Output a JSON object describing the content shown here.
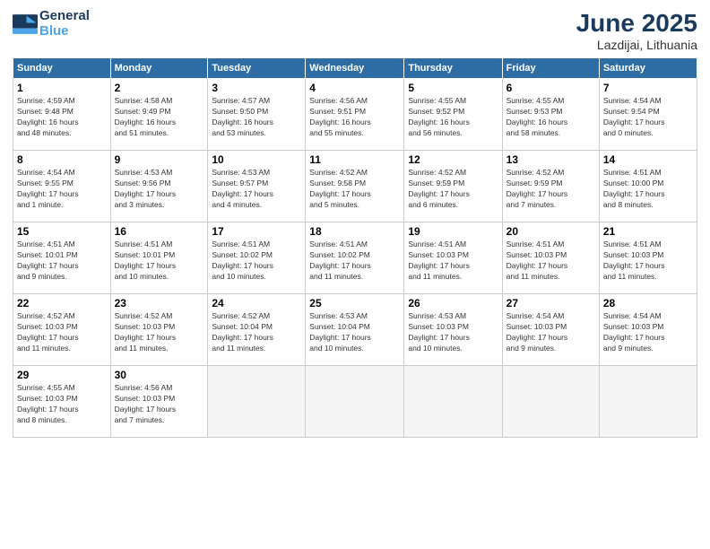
{
  "header": {
    "logo_line1": "General",
    "logo_line2": "Blue",
    "month": "June 2025",
    "location": "Lazdijai, Lithuania"
  },
  "weekdays": [
    "Sunday",
    "Monday",
    "Tuesday",
    "Wednesday",
    "Thursday",
    "Friday",
    "Saturday"
  ],
  "weeks": [
    [
      {
        "day": "1",
        "info": "Sunrise: 4:59 AM\nSunset: 9:48 PM\nDaylight: 16 hours\nand 48 minutes."
      },
      {
        "day": "2",
        "info": "Sunrise: 4:58 AM\nSunset: 9:49 PM\nDaylight: 16 hours\nand 51 minutes."
      },
      {
        "day": "3",
        "info": "Sunrise: 4:57 AM\nSunset: 9:50 PM\nDaylight: 16 hours\nand 53 minutes."
      },
      {
        "day": "4",
        "info": "Sunrise: 4:56 AM\nSunset: 9:51 PM\nDaylight: 16 hours\nand 55 minutes."
      },
      {
        "day": "5",
        "info": "Sunrise: 4:55 AM\nSunset: 9:52 PM\nDaylight: 16 hours\nand 56 minutes."
      },
      {
        "day": "6",
        "info": "Sunrise: 4:55 AM\nSunset: 9:53 PM\nDaylight: 16 hours\nand 58 minutes."
      },
      {
        "day": "7",
        "info": "Sunrise: 4:54 AM\nSunset: 9:54 PM\nDaylight: 17 hours\nand 0 minutes."
      }
    ],
    [
      {
        "day": "8",
        "info": "Sunrise: 4:54 AM\nSunset: 9:55 PM\nDaylight: 17 hours\nand 1 minute."
      },
      {
        "day": "9",
        "info": "Sunrise: 4:53 AM\nSunset: 9:56 PM\nDaylight: 17 hours\nand 3 minutes."
      },
      {
        "day": "10",
        "info": "Sunrise: 4:53 AM\nSunset: 9:57 PM\nDaylight: 17 hours\nand 4 minutes."
      },
      {
        "day": "11",
        "info": "Sunrise: 4:52 AM\nSunset: 9:58 PM\nDaylight: 17 hours\nand 5 minutes."
      },
      {
        "day": "12",
        "info": "Sunrise: 4:52 AM\nSunset: 9:59 PM\nDaylight: 17 hours\nand 6 minutes."
      },
      {
        "day": "13",
        "info": "Sunrise: 4:52 AM\nSunset: 9:59 PM\nDaylight: 17 hours\nand 7 minutes."
      },
      {
        "day": "14",
        "info": "Sunrise: 4:51 AM\nSunset: 10:00 PM\nDaylight: 17 hours\nand 8 minutes."
      }
    ],
    [
      {
        "day": "15",
        "info": "Sunrise: 4:51 AM\nSunset: 10:01 PM\nDaylight: 17 hours\nand 9 minutes."
      },
      {
        "day": "16",
        "info": "Sunrise: 4:51 AM\nSunset: 10:01 PM\nDaylight: 17 hours\nand 10 minutes."
      },
      {
        "day": "17",
        "info": "Sunrise: 4:51 AM\nSunset: 10:02 PM\nDaylight: 17 hours\nand 10 minutes."
      },
      {
        "day": "18",
        "info": "Sunrise: 4:51 AM\nSunset: 10:02 PM\nDaylight: 17 hours\nand 11 minutes."
      },
      {
        "day": "19",
        "info": "Sunrise: 4:51 AM\nSunset: 10:03 PM\nDaylight: 17 hours\nand 11 minutes."
      },
      {
        "day": "20",
        "info": "Sunrise: 4:51 AM\nSunset: 10:03 PM\nDaylight: 17 hours\nand 11 minutes."
      },
      {
        "day": "21",
        "info": "Sunrise: 4:51 AM\nSunset: 10:03 PM\nDaylight: 17 hours\nand 11 minutes."
      }
    ],
    [
      {
        "day": "22",
        "info": "Sunrise: 4:52 AM\nSunset: 10:03 PM\nDaylight: 17 hours\nand 11 minutes."
      },
      {
        "day": "23",
        "info": "Sunrise: 4:52 AM\nSunset: 10:03 PM\nDaylight: 17 hours\nand 11 minutes."
      },
      {
        "day": "24",
        "info": "Sunrise: 4:52 AM\nSunset: 10:04 PM\nDaylight: 17 hours\nand 11 minutes."
      },
      {
        "day": "25",
        "info": "Sunrise: 4:53 AM\nSunset: 10:04 PM\nDaylight: 17 hours\nand 10 minutes."
      },
      {
        "day": "26",
        "info": "Sunrise: 4:53 AM\nSunset: 10:03 PM\nDaylight: 17 hours\nand 10 minutes."
      },
      {
        "day": "27",
        "info": "Sunrise: 4:54 AM\nSunset: 10:03 PM\nDaylight: 17 hours\nand 9 minutes."
      },
      {
        "day": "28",
        "info": "Sunrise: 4:54 AM\nSunset: 10:03 PM\nDaylight: 17 hours\nand 9 minutes."
      }
    ],
    [
      {
        "day": "29",
        "info": "Sunrise: 4:55 AM\nSunset: 10:03 PM\nDaylight: 17 hours\nand 8 minutes."
      },
      {
        "day": "30",
        "info": "Sunrise: 4:56 AM\nSunset: 10:03 PM\nDaylight: 17 hours\nand 7 minutes."
      },
      {
        "day": "",
        "info": ""
      },
      {
        "day": "",
        "info": ""
      },
      {
        "day": "",
        "info": ""
      },
      {
        "day": "",
        "info": ""
      },
      {
        "day": "",
        "info": ""
      }
    ]
  ]
}
